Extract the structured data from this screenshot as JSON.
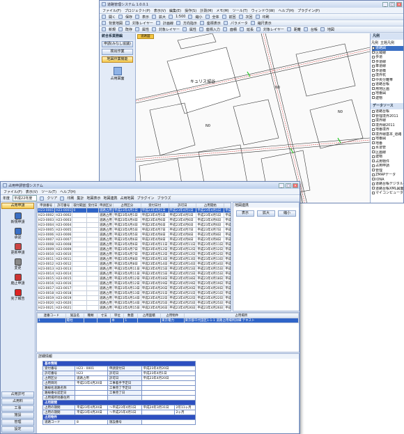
{
  "back_window": {
    "title": "道路管理システム 1.0.0.1",
    "menu": [
      "ファイル(F)",
      "プロジェクト(P)",
      "表示(V)",
      "編集(E)",
      "操作(S)",
      "計測(M)",
      "メモ(M)",
      "ツール(T)",
      "ウィンドウ(W)",
      "ヘルプ(H)",
      "プラグイン(P)"
    ],
    "toolbar1": [
      "開く",
      "保存",
      "表示",
      "拡大",
      "1:500",
      "縮小",
      "全体",
      "前回",
      "次回",
      "印刷"
    ],
    "toolbar2": [
      "背景地図",
      "対象レイヤー",
      "計画線",
      "方向指示",
      "座標表示",
      "パラメータ",
      "縮尺表示"
    ],
    "toolbar3": [
      "新規",
      "既存",
      "属性",
      "対象レイヤー",
      "属性",
      "座標入力",
      "面積",
      "延長",
      "対象レイヤー",
      "距離",
      "台帳",
      "地図"
    ],
    "left_header": "統合系業務編",
    "left_buttons": [
      "申請(みなし協議)",
      "検出作業",
      "地図作業機能"
    ],
    "left_icon_label": "占用図面",
    "map_tab": "道路図",
    "map_labels": {
      "building": "キュリス城谷",
      "road": "五管掘一丁目",
      "n1": "N0",
      "n2": "N0",
      "n3": "N0"
    },
    "right_panel_title": "凡例",
    "right_tabs": [
      "凡例",
      "主題凡例"
    ],
    "legend_items": [
      "道路図",
      "区域線",
      "歩道",
      "歩道線",
      "車道線",
      "歩道橋",
      "境界杭",
      "中央分離帯",
      "道路台帳",
      "用地区画",
      "地番図",
      "建物"
    ],
    "data_source_title": "データソース",
    "data_sources": [
      "道路台帳",
      "管理境界2011",
      "境界線",
      "境界線2011",
      "地番境界",
      "境界線基本_道路",
      "地番図",
      "地番",
      "水道管",
      "区画線",
      "建物",
      "占用物件",
      "占用申請",
      "管理",
      "ZMAPデータ",
      "IONA",
      "道路台帳デジタルデータ",
      "道路台帳XML図面",
      "マイコンピュータ"
    ]
  },
  "front_window": {
    "title": "占用申請管理システム",
    "menu": [
      "ファイル(F)",
      "表示(V)",
      "ツール(T)",
      "ヘルプ(H)"
    ],
    "toolbar": [
      "年度",
      "平成22年度",
      "クリア",
      "印刷",
      "集計",
      "地図表示",
      "地図連携",
      "占用地図",
      "プラグイン",
      "ブラウズ"
    ],
    "left_header": "占用申請",
    "left_items": [
      "新規申請",
      "承認",
      "更新申請",
      "変更",
      "廃止申請",
      "完了報告"
    ],
    "bottom_nav": [
      "占用許可",
      "占用料",
      "工事",
      "施設",
      "管理",
      "設定"
    ],
    "grid_headers": [
      "申請番号",
      "許可番号",
      "取付範囲",
      "受付日",
      "申請区分",
      "占用区分",
      "受付日付",
      "許可日",
      "占用開始",
      "占用終了",
      "種別"
    ],
    "grid_rows": [
      [
        "H23-0001",
        "H23-0001",
        "0",
        "",
        "道路占用",
        "平成23年4月1日",
        "平成23年4月1日",
        "平成23年4月1日",
        "平成23年4月1日",
        "平成24年3月31日",
        "電柱"
      ],
      [
        "H23-0002",
        "H23-0002",
        "",
        "",
        "道路占用",
        "平成23年4月1日",
        "平成23年4月5日",
        "平成23年4月5日",
        "平成23年4月5日",
        "平成24年3月31日",
        "電柱"
      ],
      [
        "H23-0003",
        "H23-0003",
        "",
        "",
        "道路占用",
        "平成23年4月4日",
        "平成23年4月6日",
        "平成23年4月6日",
        "平成23年4月6日",
        "平成24年3月31日",
        "電柱"
      ],
      [
        "H23-0004",
        "H23-0004",
        "",
        "",
        "道路占用",
        "平成23年4月4日",
        "平成23年4月6日",
        "平成23年4月6日",
        "平成23年4月6日",
        "平成24年3月31日",
        "電柱"
      ],
      [
        "H23-0005",
        "H23-0005",
        "",
        "",
        "道路占用",
        "平成23年4月5日",
        "平成23年4月7日",
        "平成23年4月7日",
        "平成23年4月7日",
        "平成24年3月31日",
        "ガス"
      ],
      [
        "H23-0006",
        "H23-0006",
        "",
        "",
        "道路占用",
        "平成23年4月5日",
        "平成23年4月8日",
        "平成23年4月8日",
        "平成23年4月8日",
        "平成24年3月31日",
        "ガス"
      ],
      [
        "H23-0007",
        "H23-0007",
        "",
        "",
        "道路占用",
        "平成23年4月6日",
        "平成23年4月8日",
        "平成23年4月8日",
        "平成23年4月8日",
        "平成24年3月31日",
        "水道"
      ],
      [
        "H23-0008",
        "H23-0008",
        "",
        "",
        "道路占用",
        "平成23年4月6日",
        "平成23年4月11日",
        "平成23年4月11日",
        "平成23年4月11日",
        "平成24年3月31日",
        "水道"
      ],
      [
        "H23-0009",
        "H23-0009",
        "",
        "",
        "道路占用",
        "平成23年4月7日",
        "平成23年4月12日",
        "平成23年4月12日",
        "平成23年4月12日",
        "平成24年3月31日",
        "下水"
      ],
      [
        "H23-0010",
        "H23-0010",
        "",
        "",
        "道路占用",
        "平成23年4月7日",
        "平成23年4月12日",
        "平成23年4月12日",
        "平成23年4月12日",
        "平成24年3月31日",
        "下水"
      ],
      [
        "H23-0011",
        "H23-0011",
        "",
        "",
        "道路占用",
        "平成23年4月8日",
        "平成23年4月13日",
        "平成23年4月13日",
        "平成23年4月13日",
        "平成24年3月31日",
        "電話"
      ],
      [
        "H23-0012",
        "H23-0012",
        "",
        "",
        "道路占用",
        "平成23年4月8日",
        "平成23年4月14日",
        "平成23年4月14日",
        "平成23年4月14日",
        "平成24年3月31日",
        "電話"
      ],
      [
        "H23-0013",
        "H23-0013",
        "",
        "",
        "道路占用",
        "平成23年4月11日",
        "平成23年4月15日",
        "平成23年4月15日",
        "平成23年4月15日",
        "平成24年3月31日",
        "看板"
      ],
      [
        "H23-0014",
        "H23-0014",
        "",
        "",
        "道路占用",
        "平成23年4月11日",
        "平成23年4月15日",
        "平成23年4月15日",
        "平成23年4月15日",
        "平成24年3月31日",
        "看板"
      ],
      [
        "H23-0015",
        "H23-0015",
        "",
        "",
        "道路占用",
        "平成23年4月12日",
        "平成23年4月18日",
        "平成23年4月18日",
        "平成23年4月18日",
        "平成24年3月31日",
        "電柱"
      ],
      [
        "H23-0016",
        "H23-0016",
        "",
        "",
        "道路占用",
        "平成23年4月12日",
        "平成23年4月19日",
        "平成23年4月19日",
        "平成23年4月19日",
        "平成24年3月31日",
        "電柱"
      ],
      [
        "H23-0017",
        "H23-0017",
        "",
        "",
        "道路占用",
        "平成23年4月13日",
        "平成23年4月20日",
        "平成23年4月20日",
        "平成23年4月20日",
        "平成24年3月31日",
        "ガス"
      ],
      [
        "H23-0018",
        "H23-0018",
        "",
        "",
        "道路占用",
        "平成23年4月13日",
        "平成23年4月21日",
        "平成23年4月21日",
        "平成23年4月21日",
        "平成24年3月31日",
        "水道"
      ],
      [
        "H23-0019",
        "H23-0019",
        "",
        "",
        "道路占用",
        "平成23年4月14日",
        "平成23年4月22日",
        "平成23年4月22日",
        "平成23年4月22日",
        "平成24年3月31日",
        "下水"
      ],
      [
        "H23-0020",
        "H23-0020",
        "",
        "",
        "道路占用",
        "平成23年4月14日",
        "平成23年4月25日",
        "平成23年4月25日",
        "平成23年4月25日",
        "平成24年3月31日",
        "電話"
      ],
      [
        "H23-0021",
        "H23-0021",
        "",
        "",
        "道路占用",
        "平成23年4月15日",
        "平成23年4月26日",
        "平成23年4月26日",
        "平成23年4月26日",
        "平成24年3月31日",
        "看板"
      ],
      [
        "H23-0022",
        "H23-0022",
        "",
        "",
        "道路占用",
        "平成23年4月15日",
        "平成23年4月27日",
        "平成23年4月27日",
        "平成23年4月27日",
        "平成24年3月31日",
        "電柱"
      ]
    ],
    "right_pane_title": "地図連携",
    "right_pane_buttons": [
      "表示",
      "拡大",
      "縮小"
    ],
    "detail_headers": [
      "連番コード",
      "施設名",
      "種類",
      "寸法",
      "単位",
      "数量",
      "占用面積",
      "占用物件",
      "占用場所"
    ],
    "detail_row": [
      "1",
      "電柱",
      "",
      "",
      "本",
      "1",
      "",
      "東京電力",
      "東京都千代田区1-1-1 道路占用場所詳細 テキスト"
    ],
    "info_section_title": "詳細情報",
    "info": {
      "basic": "基本情報",
      "rows": [
        [
          "受付番号",
          "H23 - 0001",
          "申請受付日",
          "平成23年4月20日"
        ],
        [
          "許可番号",
          "H23",
          "許可日",
          "平成23年4月1日"
        ],
        [
          "占用区分",
          "道路占用",
          "許可日",
          "平成23年4月20日"
        ],
        [
          "占用目的",
          "平成23年4月20日",
          "工事着手予定日",
          ""
        ],
        [
          "路線名道路名称",
          "",
          "工事完了予定日",
          ""
        ],
        [
          "路線番号認定日",
          "",
          "工事完了日",
          ""
        ],
        [
          "占用場所地番住所",
          "",
          "",
          ""
        ]
      ],
      "period_title": "占用期間",
      "period_rows": [
        [
          "占用の期間",
          "平成23年4月20日",
          "～平成23年4月1日",
          "平成24年3月31日",
          "2年11ヶ月"
        ],
        [
          "占用の期間",
          "平成23年4月20日",
          "～平成25年4月1日",
          "",
          "2ヶ月"
        ]
      ],
      "object_title": "占用物件",
      "object_row": [
        "道路コード",
        "8",
        "施設番号",
        ""
      ]
    }
  }
}
